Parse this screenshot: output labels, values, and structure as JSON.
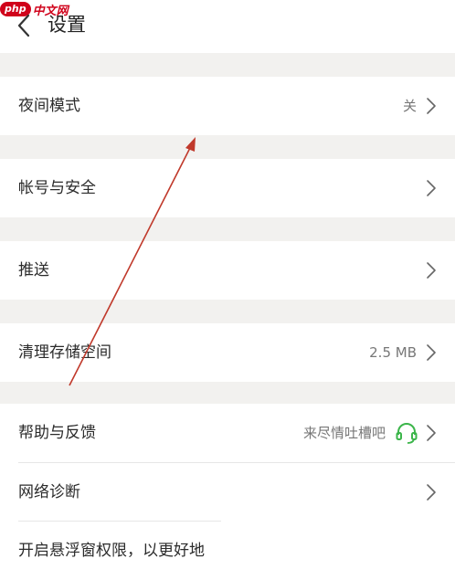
{
  "watermark": {
    "logo": "php",
    "text": "中文网"
  },
  "header": {
    "title": "设置"
  },
  "rows": [
    {
      "label": "夜间模式",
      "value": "关"
    },
    {
      "label": "帐号与安全",
      "value": ""
    },
    {
      "label": "推送",
      "value": ""
    },
    {
      "label": "清理存储空间",
      "value": "2.5 MB"
    },
    {
      "label": "帮助与反馈",
      "value": "来尽情吐槽吧"
    },
    {
      "label": "网络诊断",
      "value": ""
    },
    {
      "label": "开启悬浮窗权限，以更好地",
      "value": ""
    }
  ],
  "colors": {
    "accent_green": "#3bb54a",
    "annotation_red": "#c0392b",
    "gap_gray": "#f2f1ef"
  },
  "icons": {
    "back": "chevron-left-icon",
    "row": "chevron-right-icon",
    "feedback": "headset-icon"
  }
}
